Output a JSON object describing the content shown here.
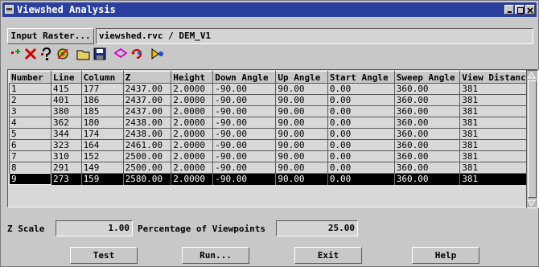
{
  "window": {
    "title": "Viewshed Analysis"
  },
  "raster": {
    "button_label": "Input Raster...",
    "path": "viewshed.rvc / DEM_V1"
  },
  "toolbar": [
    {
      "name": "add-point-icon"
    },
    {
      "name": "delete-icon"
    },
    {
      "name": "select-point-icon"
    },
    {
      "name": "settings-icon"
    },
    {
      "name": "open-icon"
    },
    {
      "name": "save-icon"
    },
    {
      "name": "shape-icon"
    },
    {
      "name": "refresh-icon"
    },
    {
      "name": "run-icon"
    }
  ],
  "table": {
    "columns": [
      "Number",
      "Line",
      "Column",
      "Z",
      "Height",
      "Down Angle",
      "Up Angle",
      "Start Angle",
      "Sweep Angle",
      "View Distance"
    ],
    "rows": [
      [
        "1",
        "415",
        "177",
        "2437.00",
        "2.0000",
        "-90.00",
        "90.00",
        "0.00",
        "360.00",
        "381"
      ],
      [
        "2",
        "401",
        "186",
        "2437.00",
        "2.0000",
        "-90.00",
        "90.00",
        "0.00",
        "360.00",
        "381"
      ],
      [
        "3",
        "380",
        "185",
        "2437.00",
        "2.0000",
        "-90.00",
        "90.00",
        "0.00",
        "360.00",
        "381"
      ],
      [
        "4",
        "362",
        "180",
        "2438.00",
        "2.0000",
        "-90.00",
        "90.00",
        "0.00",
        "360.00",
        "381"
      ],
      [
        "5",
        "344",
        "174",
        "2438.00",
        "2.0000",
        "-90.00",
        "90.00",
        "0.00",
        "360.00",
        "381"
      ],
      [
        "6",
        "323",
        "164",
        "2461.00",
        "2.0000",
        "-90.00",
        "90.00",
        "0.00",
        "360.00",
        "381"
      ],
      [
        "7",
        "310",
        "152",
        "2500.00",
        "2.0000",
        "-90.00",
        "90.00",
        "0.00",
        "360.00",
        "381"
      ],
      [
        "8",
        "291",
        "149",
        "2500.00",
        "2.0000",
        "-90.00",
        "90.00",
        "0.00",
        "360.00",
        "381"
      ],
      [
        "9",
        "273",
        "159",
        "2580.00",
        "2.0000",
        "-90.00",
        "90.00",
        "0.00",
        "360.00",
        "381"
      ]
    ],
    "selected_row": 8
  },
  "zscale": {
    "label": "Z Scale",
    "value": "1.00"
  },
  "percent": {
    "label": "Percentage of Viewpoints",
    "value": "25.00"
  },
  "buttons": {
    "test": "Test",
    "run": "Run...",
    "exit": "Exit",
    "help": "Help"
  },
  "colors": {
    "titlebar": "#2a3f9e",
    "selected_row": "#000000"
  }
}
